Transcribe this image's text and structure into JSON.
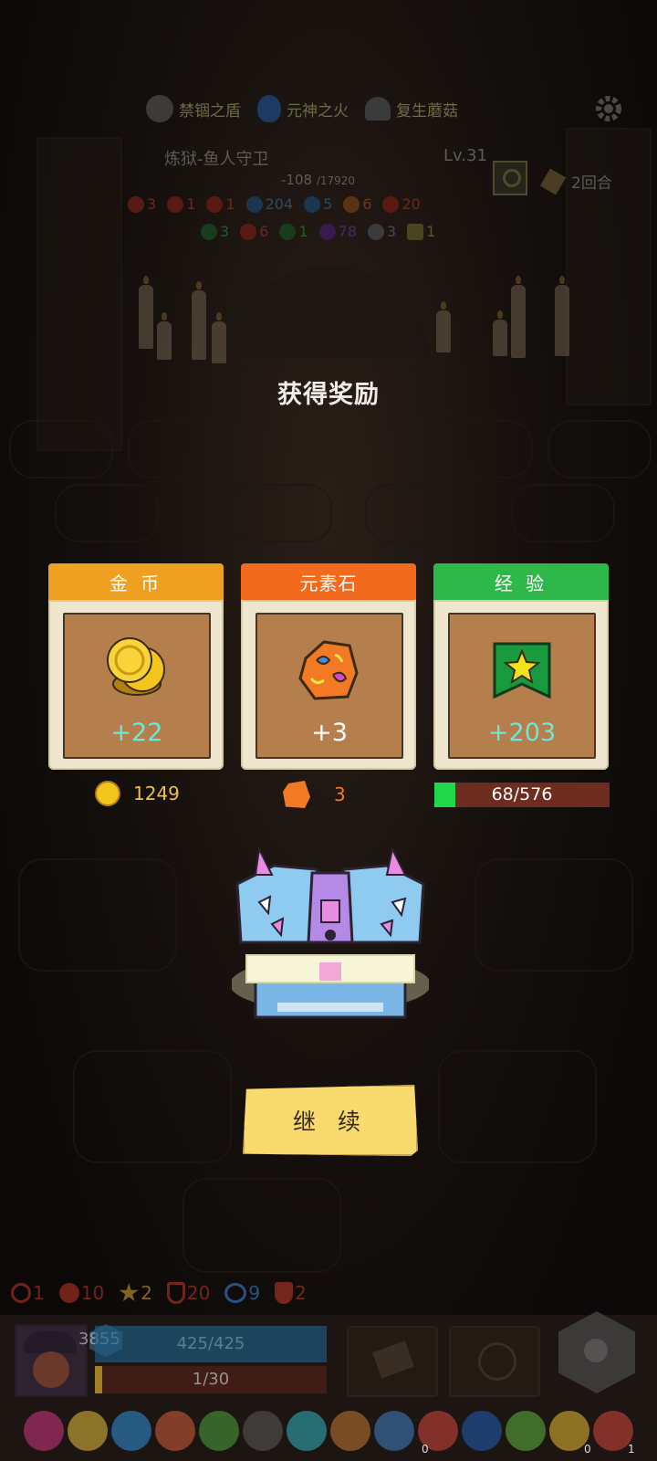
{
  "header": {
    "buffs": [
      {
        "icon": "shield-icon",
        "label": "禁锢之盾"
      },
      {
        "icon": "blue-flame-icon",
        "label": "元神之火"
      },
      {
        "icon": "mushroom-icon",
        "label": "复生蘑菇"
      }
    ],
    "enemy_name": "炼狱-鱼人守卫",
    "enemy_level": "Lv.31",
    "enemy_hp": "-108",
    "enemy_hp_max": "/17920",
    "turns": "2回合",
    "enemy_stats_row1": [
      {
        "icon": "red-slash-icon",
        "value": "3"
      },
      {
        "icon": "red-spiral-icon",
        "value": "1"
      },
      {
        "icon": "red-fist-icon",
        "value": "1"
      },
      {
        "icon": "blue-snow-icon",
        "value": "204"
      },
      {
        "icon": "blue-chat-icon",
        "value": "5"
      },
      {
        "icon": "orange-flame-icon",
        "value": "6"
      },
      {
        "icon": "red-skull-icon",
        "value": "20"
      }
    ],
    "enemy_stats_row2": [
      {
        "icon": "green-leaf-icon",
        "value": "3"
      },
      {
        "icon": "red-fire-icon",
        "value": "6"
      },
      {
        "icon": "green-swirl-icon",
        "value": "1"
      },
      {
        "icon": "purple-star-icon",
        "value": "78"
      },
      {
        "icon": "skull-icon",
        "value": "3"
      },
      {
        "icon": "lock-icon",
        "value": "1"
      }
    ]
  },
  "dialog": {
    "title": "获得奖励",
    "rewards": [
      {
        "header": "金 币",
        "amount": "+22",
        "header_color": "#f0a020",
        "amount_color": "#6be8d8",
        "icon": "gold-coins-icon"
      },
      {
        "header": "元素石",
        "amount": "+3",
        "header_color": "#f26a1c",
        "amount_color": "#ffffff",
        "icon": "element-stone-icon"
      },
      {
        "header": "经 验",
        "amount": "+203",
        "header_color": "#2fb84a",
        "amount_color": "#6be8d8",
        "icon": "experience-badge-icon"
      }
    ],
    "gold_total": "1249",
    "stone_total": "3",
    "exp_text": "68/576",
    "exp_progress": 0.118,
    "continue_label": "继 续"
  },
  "player": {
    "bottom_stats": [
      {
        "icon": "spiral-icon",
        "value": "1"
      },
      {
        "icon": "gear-burst-icon",
        "value": "10"
      },
      {
        "icon": "star-burst-icon",
        "value": "2"
      },
      {
        "icon": "shield-icon",
        "value": "20"
      },
      {
        "icon": "eye-icon",
        "value": "9"
      },
      {
        "icon": "check-shield-icon",
        "value": "2"
      }
    ],
    "armor": "3855",
    "hp": "425/425",
    "energy": "1/30",
    "counters": [
      "0",
      "0",
      "1"
    ]
  }
}
